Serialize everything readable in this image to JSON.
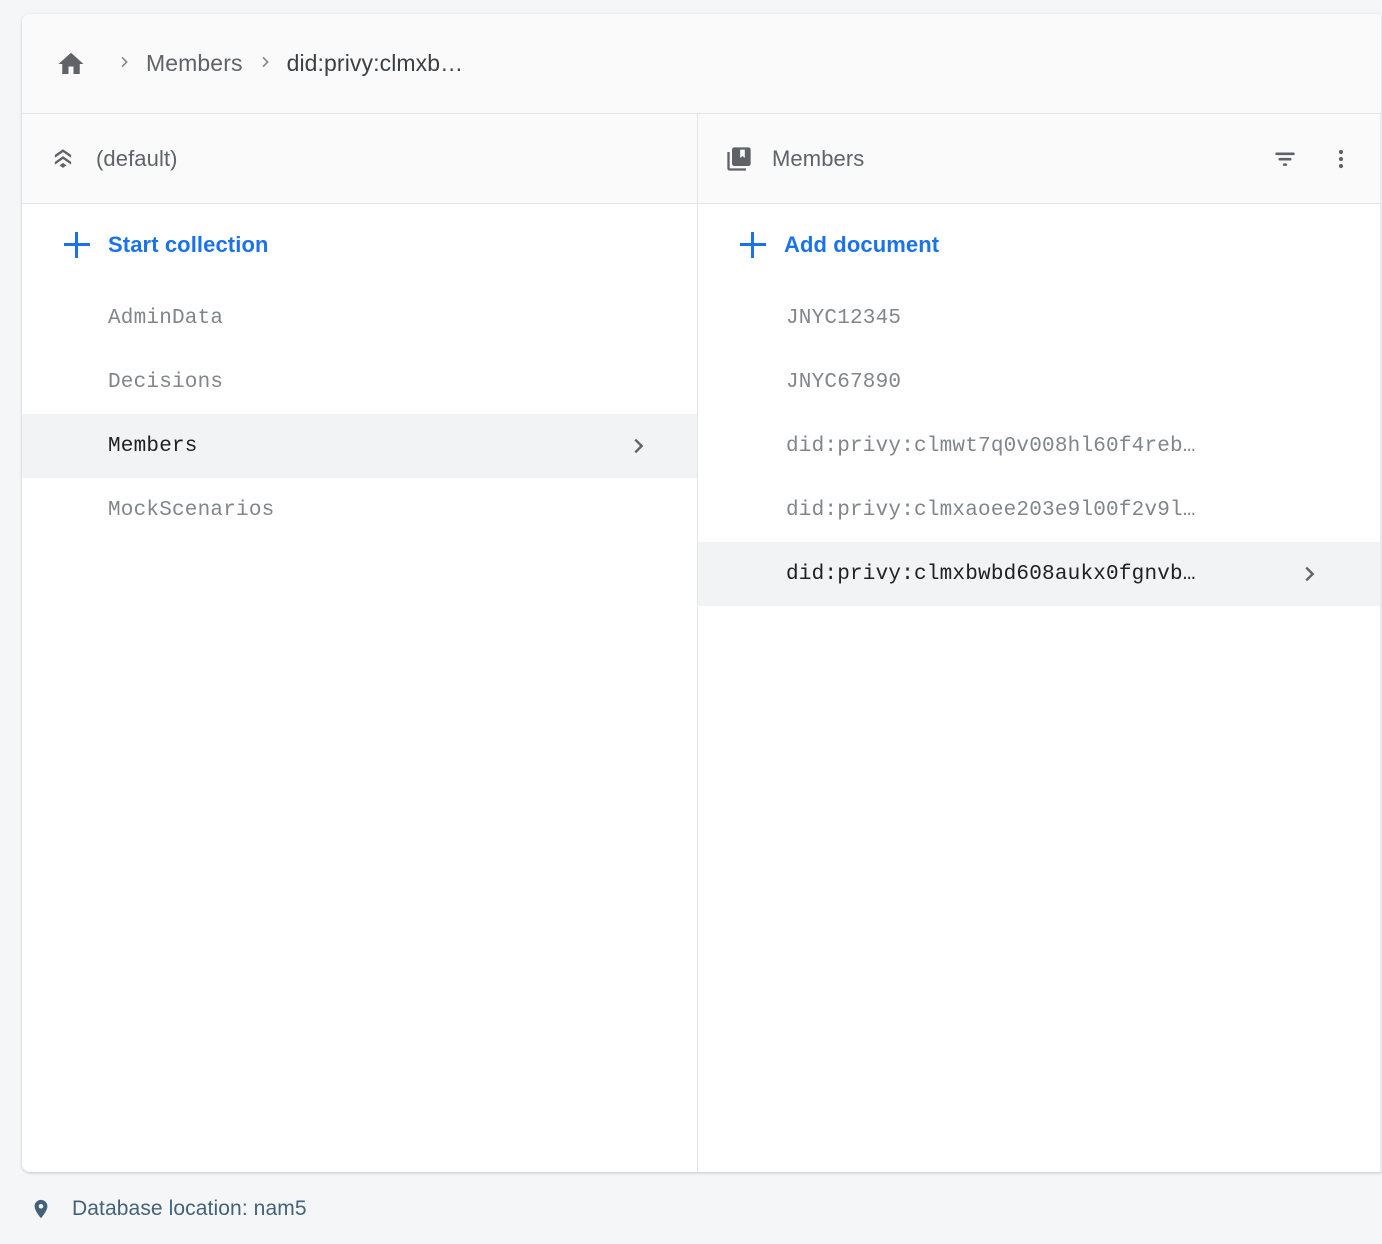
{
  "breadcrumb": {
    "home_icon": "home-icon",
    "separator": "chevron-right-icon",
    "items": [
      {
        "label": "Members",
        "current": false
      },
      {
        "label": "did:privy:clmxb…",
        "current": true
      }
    ]
  },
  "collections_panel": {
    "icon": "database-stack-icon",
    "title": "(default)",
    "add_label": "Start collection",
    "add_icon": "plus-icon",
    "items": [
      {
        "label": "AdminData",
        "selected": false
      },
      {
        "label": "Decisions",
        "selected": false
      },
      {
        "label": "Members",
        "selected": true
      },
      {
        "label": "MockScenarios",
        "selected": false
      }
    ]
  },
  "documents_panel": {
    "icon": "collections-bookmark-icon",
    "title": "Members",
    "filter_icon": "filter-list-icon",
    "menu_icon": "more-vert-icon",
    "add_label": "Add document",
    "add_icon": "plus-icon",
    "items": [
      {
        "label": "JNYC12345",
        "selected": false
      },
      {
        "label": "JNYC67890",
        "selected": false
      },
      {
        "label": "did:privy:clmwt7q0v008hl60f4reb…",
        "selected": false
      },
      {
        "label": "did:privy:clmxaoee203e9l00f2v9l…",
        "selected": false
      },
      {
        "label": "did:privy:clmxbwbd608aukx0fgnvb…",
        "selected": true
      }
    ]
  },
  "footer": {
    "icon": "location-pin-icon",
    "text": "Database location: nam5"
  },
  "colors": {
    "accent_blue": "#1a73e8",
    "text_primary": "#202124",
    "text_secondary": "#5f6368",
    "text_muted": "#80868b",
    "row_selected_bg": "#f1f3f4",
    "header_bg": "#fafafa",
    "page_bg": "#f4f6f8",
    "footer_text": "#44617b"
  }
}
